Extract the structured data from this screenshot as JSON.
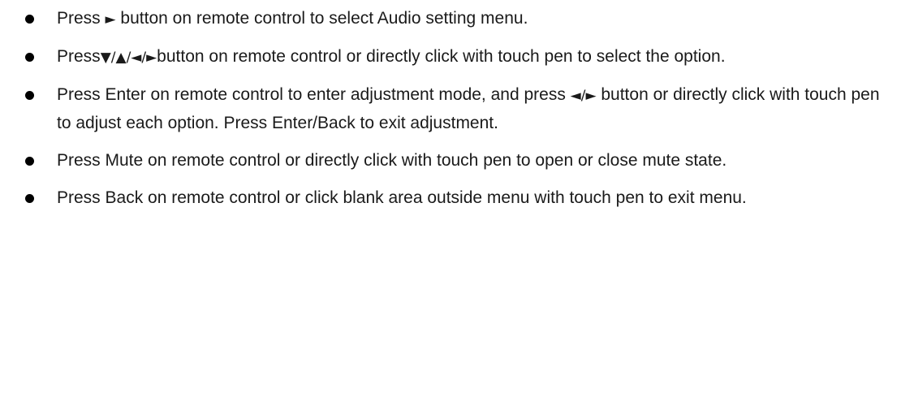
{
  "instructions": [
    {
      "parts": [
        "Press ",
        "►",
        " button on remote control to select Audio setting menu."
      ]
    },
    {
      "parts": [
        "Press",
        "▼/▲/◄/►",
        "button on remote control or directly click with touch pen to select the option."
      ]
    },
    {
      "parts": [
        "Press Enter on remote control to enter adjustment mode, and press ",
        "◄/►",
        " button or directly click with touch pen to adjust each option. Press Enter/Back to exit adjustment."
      ]
    },
    {
      "text": "Press Mute on remote control or directly click with touch pen to open or close mute state."
    },
    {
      "text": "Press Back on remote control or click blank area outside menu with touch pen to exit menu."
    }
  ]
}
